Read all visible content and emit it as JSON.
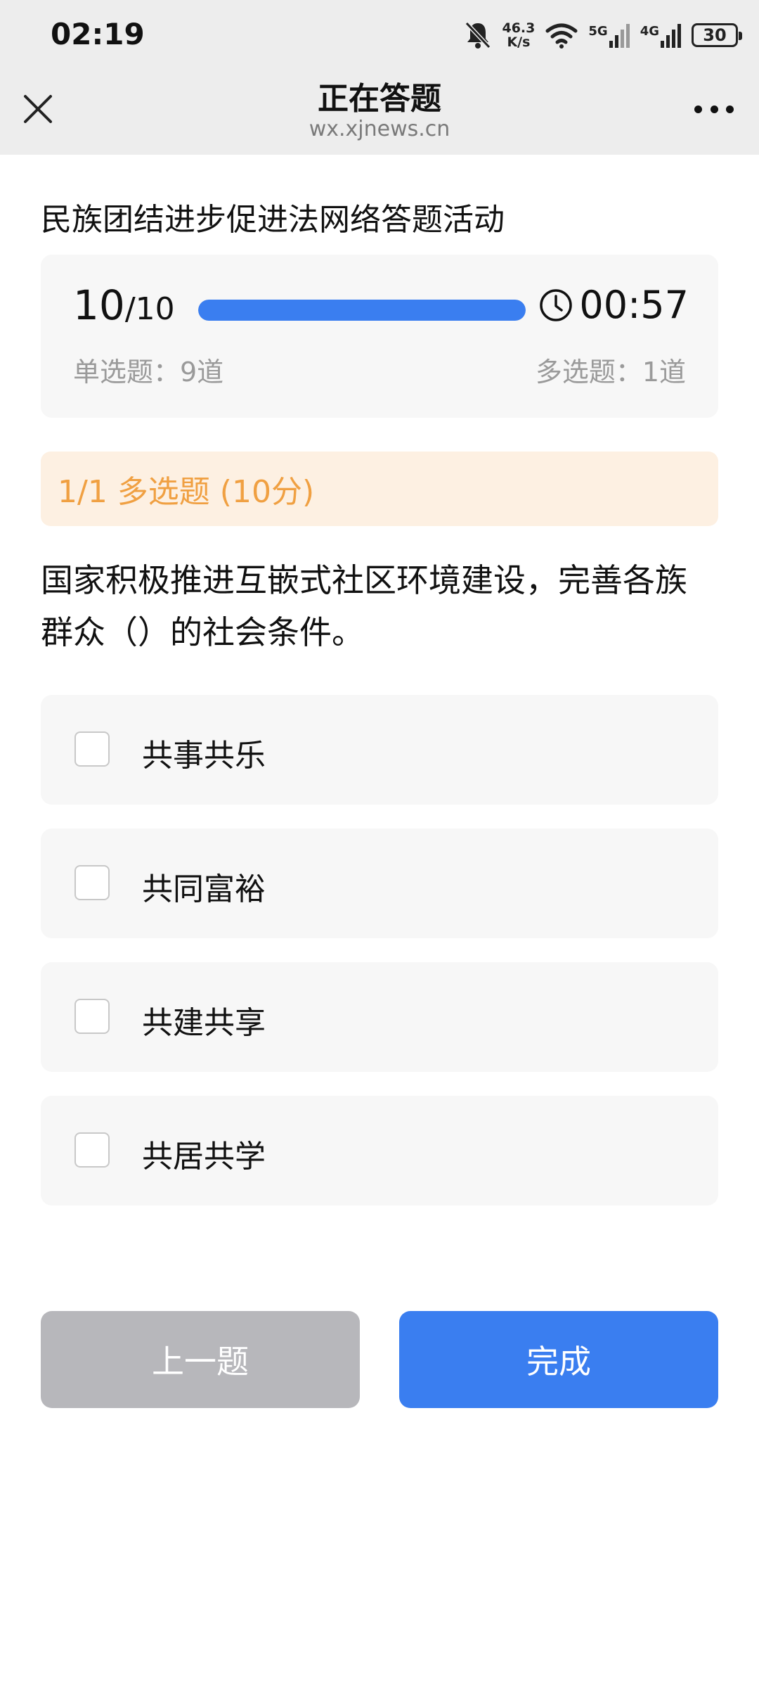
{
  "status_bar": {
    "time": "02:19",
    "net_speed_value": "46.3",
    "net_speed_unit": "K/s",
    "signal_1_label": "5G",
    "signal_2_label": "4G",
    "battery": "30"
  },
  "header": {
    "title": "正在答题",
    "url": "wx.xjnews.cn"
  },
  "activity_title": "民族团结进步促进法网络答题活动",
  "progress": {
    "current": "10",
    "total": "/10",
    "fraction": 1.0,
    "timer": "00:57",
    "single_choice": "单选题：9道",
    "multi_choice": "多选题：1道"
  },
  "question": {
    "banner": "1/1 多选题 (10分)",
    "text": "国家积极推进互嵌式社区环境建设，完善各族群众（）的社会条件。",
    "options": [
      {
        "label": "共事共乐",
        "checked": false
      },
      {
        "label": "共同富裕",
        "checked": false
      },
      {
        "label": "共建共享",
        "checked": false
      },
      {
        "label": "共居共学",
        "checked": false
      }
    ]
  },
  "buttons": {
    "prev": "上一题",
    "done": "完成"
  },
  "colors": {
    "accent": "#3a7ef0",
    "banner_bg": "#fdf0e2",
    "banner_text": "#f0a042",
    "disabled": "#b7b7bb"
  }
}
